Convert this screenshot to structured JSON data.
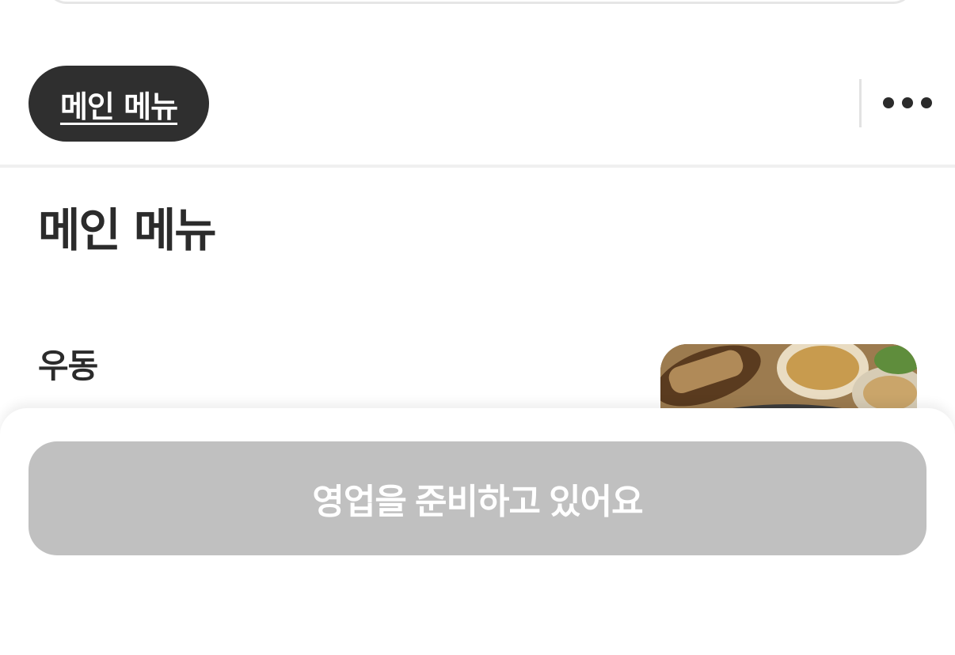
{
  "category_bar": {
    "active_category": "메인 메뉴",
    "more_icon": "more-horizontal-icon"
  },
  "section": {
    "title": "메인 메뉴"
  },
  "menu_items": [
    {
      "name": "우동",
      "photo": "udon-photo"
    }
  ],
  "bottom_sheet": {
    "order_button_label": "영업을 준비하고 있어요",
    "order_button_state": "disabled"
  },
  "colors": {
    "chip_background": "#2f2f2f",
    "disabled_button": "#c0c0c0",
    "text_primary": "#2b2b2b"
  }
}
